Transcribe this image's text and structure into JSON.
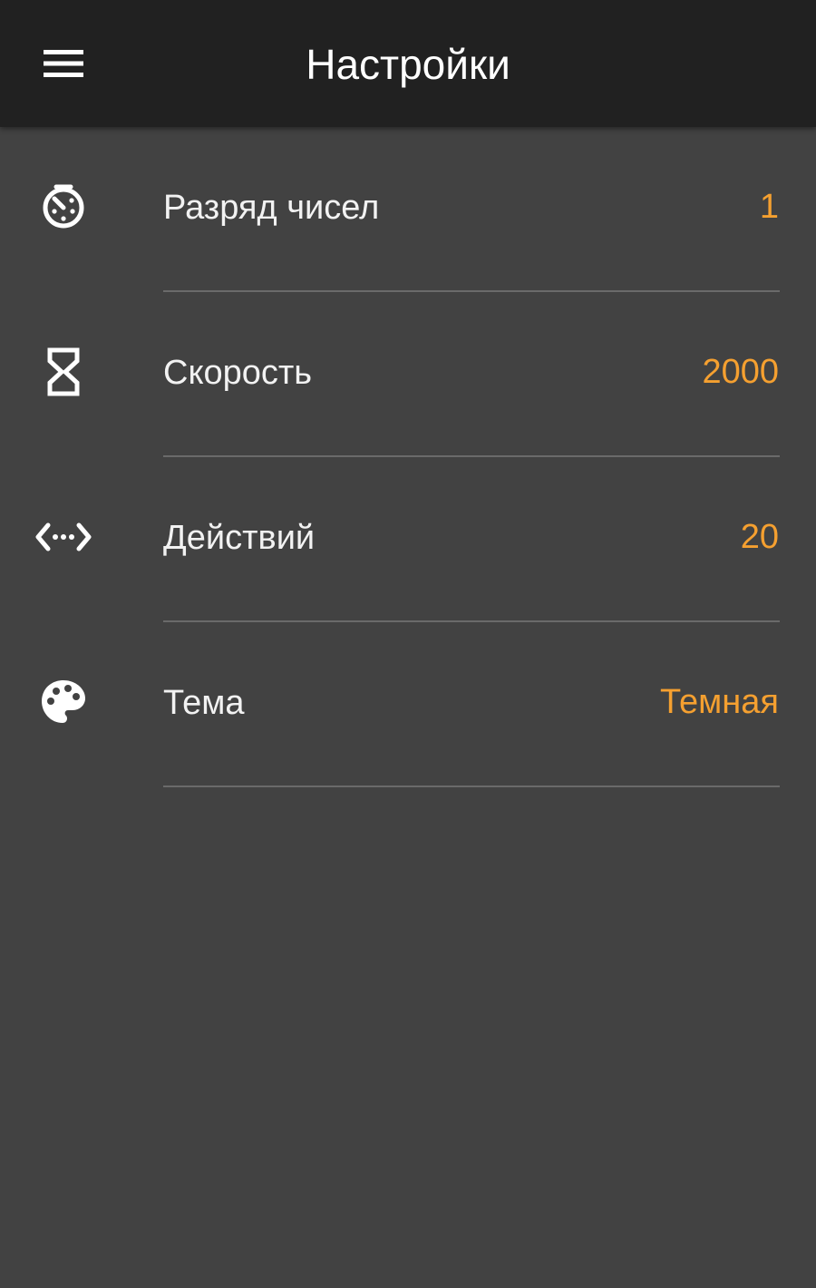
{
  "app_bar": {
    "title": "Настройки",
    "menu_icon": "hamburger-menu-icon"
  },
  "accent_color": "#f5a030",
  "settings": [
    {
      "icon": "timer-dial-icon",
      "label": "Разряд чисел",
      "value": "1"
    },
    {
      "icon": "hourglass-icon",
      "label": "Скорость",
      "value": "2000"
    },
    {
      "icon": "code-dots-icon",
      "label": "Действий",
      "value": "20"
    },
    {
      "icon": "palette-icon",
      "label": "Тема",
      "value": "Темная"
    }
  ]
}
